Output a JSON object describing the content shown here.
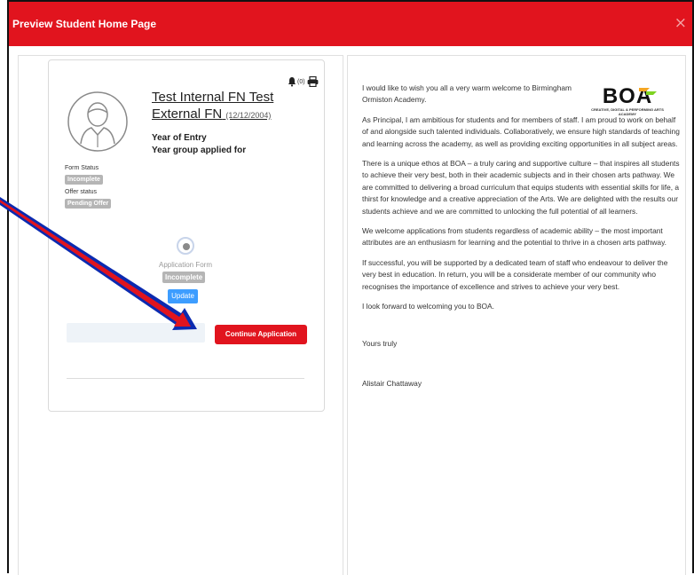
{
  "modal": {
    "title": "Preview Student Home Page",
    "close_symbol": "×"
  },
  "student": {
    "name": "Test Internal FN Test External FN",
    "dob": "(12/12/2004)",
    "year_of_entry_label": "Year of Entry",
    "year_group_label": "Year group applied for",
    "notifications_count": "(0)",
    "form_status_label": "Form Status",
    "form_status_value": "Incomplete",
    "offer_status_label": "Offer status",
    "offer_status_value": "Pending Offer"
  },
  "application": {
    "label": "Application Form",
    "status": "Incomplete",
    "update_label": "Update",
    "continue_label": "Continue Application"
  },
  "letter": {
    "paragraphs": [
      "I would like to wish you all a very warm welcome to Birmingham Ormiston Academy.",
      "As Principal, I am ambitious for students and for members of staff.  I am proud to work on behalf of and alongside such talented individuals.  Collaboratively, we ensure high standards of teaching and learning across the academy, as well as providing exciting opportunities in all subject areas.",
      "There is a unique ethos at BOA – a truly caring and supportive culture – that inspires all students to achieve their very best, both in their academic subjects and in their chosen arts pathway.  We are committed to delivering a broad curriculum that equips students with essential skills for life, a thirst for knowledge and a creative appreciation of the Arts.  We are delighted with the results our students achieve and we are committed to unlocking the full potential of all learners.",
      "We welcome applications from students regardless of academic ability – the most important attributes are an enthusiasm for learning and the potential to thrive in a chosen arts pathway.",
      "If successful, you will be supported by a dedicated team of staff who endeavour to deliver the very best in education.  In return, you will be a considerate member of our community who recognises the importance of excellence and strives to achieve your very best.",
      "I look forward to welcoming you to BOA.",
      "Yours truly",
      "Alistair Chattaway"
    ],
    "logo_text": "BOA",
    "logo_subtitle": "CREATIVE, DIGITAL & PERFORMING ARTS ACADEMY"
  },
  "colors": {
    "header_red": "#e1141e",
    "update_blue": "#3d9dff",
    "badge_grey": "#b5b5b5"
  }
}
